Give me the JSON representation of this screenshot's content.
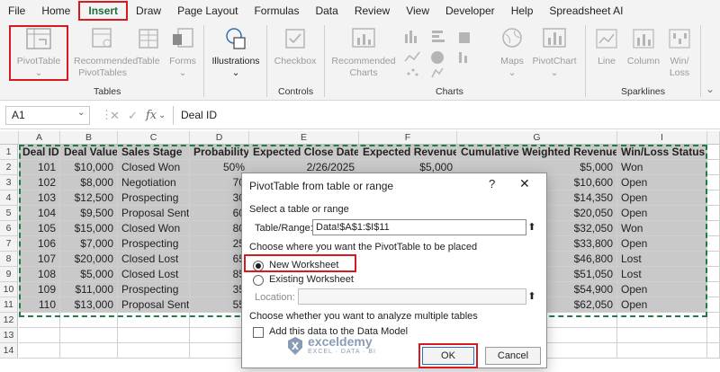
{
  "menu": {
    "items": [
      "File",
      "Home",
      "Insert",
      "Draw",
      "Page Layout",
      "Formulas",
      "Data",
      "Review",
      "View",
      "Developer",
      "Help",
      "Spreadsheet AI"
    ],
    "active": "Insert"
  },
  "ribbon": {
    "tables": {
      "pivottable": "PivotTable",
      "recommended_line1": "Recommended",
      "recommended_line2": "PivotTables",
      "table": "Table",
      "forms": "Forms",
      "label": "Tables"
    },
    "illustrations": "Illustrations",
    "controls": {
      "checkbox": "Checkbox",
      "label": "Controls"
    },
    "charts": {
      "recommended_line1": "Recommended",
      "recommended_line2": "Charts",
      "maps": "Maps",
      "pivotchart": "PivotChart",
      "label": "Charts"
    },
    "sparklines": {
      "line": "Line",
      "column": "Column",
      "winloss_line1": "Win/",
      "winloss_line2": "Loss",
      "label": "Sparklines"
    }
  },
  "formula_bar": {
    "name_box": "A1",
    "fx": "fx",
    "value": "Deal ID"
  },
  "grid": {
    "columns": [
      "A",
      "B",
      "C",
      "D",
      "E",
      "F",
      "G",
      "I"
    ],
    "rows": [
      "1",
      "2",
      "3",
      "4",
      "5",
      "6",
      "7",
      "8",
      "9",
      "10",
      "11",
      "12",
      "13",
      "14"
    ],
    "headers": {
      "deal_id": "Deal ID",
      "deal_value": "Deal Value",
      "sales_stage": "Sales Stage",
      "probability": "Probability",
      "close_date": "Expected Close Date",
      "exp_revenue": "Expected Revenue",
      "cum_revenue": "Cumulative Weighted Revenue",
      "win_loss": "Win/Loss Status"
    },
    "data": [
      {
        "id": "101",
        "value": "$10,000",
        "stage": "Closed Won",
        "prob": "50%",
        "date": "2/26/2025",
        "rev": "$5,000",
        "cum": "$5,000",
        "status": "Won"
      },
      {
        "id": "102",
        "value": "$8,000",
        "stage": "Negotiation",
        "prob": "70",
        "date": "",
        "rev": "",
        "cum": "$10,600",
        "status": "Open"
      },
      {
        "id": "103",
        "value": "$12,500",
        "stage": "Prospecting",
        "prob": "30",
        "date": "",
        "rev": "",
        "cum": "$14,350",
        "status": "Open"
      },
      {
        "id": "104",
        "value": "$9,500",
        "stage": "Proposal Sent",
        "prob": "60",
        "date": "",
        "rev": "",
        "cum": "$20,050",
        "status": "Open"
      },
      {
        "id": "105",
        "value": "$15,000",
        "stage": "Closed Won",
        "prob": "80",
        "date": "",
        "rev": "",
        "cum": "$32,050",
        "status": "Won"
      },
      {
        "id": "106",
        "value": "$7,000",
        "stage": "Prospecting",
        "prob": "25",
        "date": "",
        "rev": "",
        "cum": "$33,800",
        "status": "Open"
      },
      {
        "id": "107",
        "value": "$20,000",
        "stage": "Closed Lost",
        "prob": "65",
        "date": "",
        "rev": "",
        "cum": "$46,800",
        "status": "Lost"
      },
      {
        "id": "108",
        "value": "$5,000",
        "stage": "Closed Lost",
        "prob": "85",
        "date": "",
        "rev": "",
        "cum": "$51,050",
        "status": "Lost"
      },
      {
        "id": "109",
        "value": "$11,000",
        "stage": "Prospecting",
        "prob": "35",
        "date": "",
        "rev": "",
        "cum": "$54,900",
        "status": "Open"
      },
      {
        "id": "110",
        "value": "$13,000",
        "stage": "Proposal Sent",
        "prob": "55",
        "date": "",
        "rev": "",
        "cum": "$62,050",
        "status": "Open"
      }
    ]
  },
  "dialog": {
    "title": "PivotTable from table or range",
    "help": "?",
    "close": "✕",
    "select_label": "Select a table or range",
    "range_label": "Table/Range:",
    "range_value": "Data!$A$1:$I$11",
    "place_label": "Choose where you want the PivotTable to be placed",
    "new_ws": "New Worksheet",
    "existing_ws": "Existing Worksheet",
    "location_label": "Location:",
    "multi_label": "Choose whether you want to analyze multiple tables",
    "data_model": "Add this data to the Data Model",
    "ok": "OK",
    "cancel": "Cancel"
  },
  "watermark": {
    "name": "exceldemy",
    "sub": "EXCEL · DATA · BI"
  },
  "colors": {
    "accent_red": "#d71920",
    "excel_green": "#1e7e45",
    "selection": "#c9c9c9"
  }
}
